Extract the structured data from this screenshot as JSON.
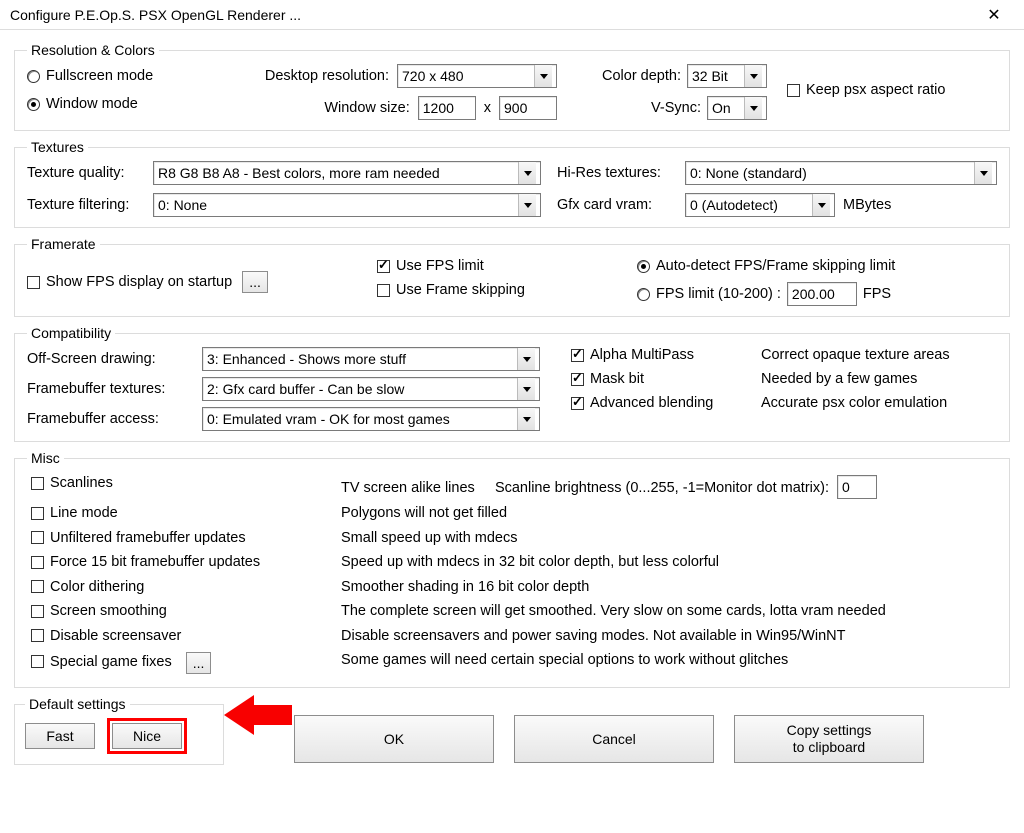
{
  "titlebar": {
    "title": "Configure P.E.Op.S. PSX OpenGL Renderer ..."
  },
  "groups": {
    "resolution": {
      "legend": "Resolution & Colors",
      "fullscreen_label": "Fullscreen mode",
      "window_label": "Window mode",
      "desktop_res_label": "Desktop resolution:",
      "desktop_res_value": "720 x 480",
      "window_size_label": "Window size:",
      "window_w": "1200",
      "window_h": "900",
      "x_char": "x",
      "color_depth_label": "Color depth:",
      "color_depth_value": "32 Bit",
      "vsync_label": "V-Sync:",
      "vsync_value": "On",
      "keep_aspect_label": "Keep psx aspect ratio"
    },
    "textures": {
      "legend": "Textures",
      "quality_label": "Texture quality:",
      "quality_value": "R8 G8 B8 A8 - Best colors, more ram needed",
      "hires_label": "Hi-Res textures:",
      "hires_value": "0: None (standard)",
      "filter_label": "Texture filtering:",
      "filter_value": "0: None",
      "vram_label": "Gfx card vram:",
      "vram_value": "0 (Autodetect)",
      "mbytes": "MBytes"
    },
    "framerate": {
      "legend": "Framerate",
      "show_fps_label": "Show FPS display on startup",
      "dots": "...",
      "use_fps_limit_label": "Use FPS limit",
      "use_frame_skip_label": "Use Frame skipping",
      "auto_detect_label": "Auto-detect FPS/Frame skipping limit",
      "fps_limit_label": "FPS limit (10-200) :",
      "fps_value": "200.00",
      "fps_unit": "FPS"
    },
    "compat": {
      "legend": "Compatibility",
      "offscreen_label": "Off-Screen drawing:",
      "offscreen_value": "3: Enhanced - Shows more stuff",
      "fbtex_label": "Framebuffer textures:",
      "fbtex_value": "2: Gfx card buffer - Can be slow",
      "fbaccess_label": "Framebuffer access:",
      "fbaccess_value": "0: Emulated vram - OK for most games",
      "alpha_label": "Alpha MultiPass",
      "alpha_desc": "Correct opaque texture areas",
      "mask_label": "Mask bit",
      "mask_desc": "Needed by a few games",
      "adv_blend_label": "Advanced blending",
      "adv_blend_desc": "Accurate psx color emulation"
    },
    "misc": {
      "legend": "Misc",
      "scanlines_label": "Scanlines",
      "scanlines_desc": "TV screen alike lines",
      "brightness_label": "Scanline brightness (0...255, -1=Monitor dot matrix):",
      "brightness_value": "0",
      "linemode_label": "Line mode",
      "linemode_desc": "Polygons will not get filled",
      "unfilt_label": "Unfiltered framebuffer updates",
      "unfilt_desc": "Small speed up with mdecs",
      "force15_label": "Force 15 bit framebuffer updates",
      "force15_desc": "Speed up with mdecs in 32 bit color depth, but less colorful",
      "dither_label": "Color dithering",
      "dither_desc": "Smoother shading in 16 bit color depth",
      "smooth_label": "Screen smoothing",
      "smooth_desc": "The complete screen will get smoothed. Very slow on some cards, lotta vram needed",
      "disable_ss_label": "Disable screensaver",
      "disable_ss_desc": "Disable screensavers and power saving modes. Not available in Win95/WinNT",
      "fixes_label": "Special game fixes",
      "fixes_btn": "...",
      "fixes_desc": "Some games will need certain special options to work without glitches"
    },
    "defaults": {
      "legend": "Default settings",
      "fast": "Fast",
      "nice": "Nice"
    }
  },
  "buttons": {
    "ok": "OK",
    "cancel": "Cancel",
    "copy1": "Copy settings",
    "copy2": "to clipboard"
  }
}
